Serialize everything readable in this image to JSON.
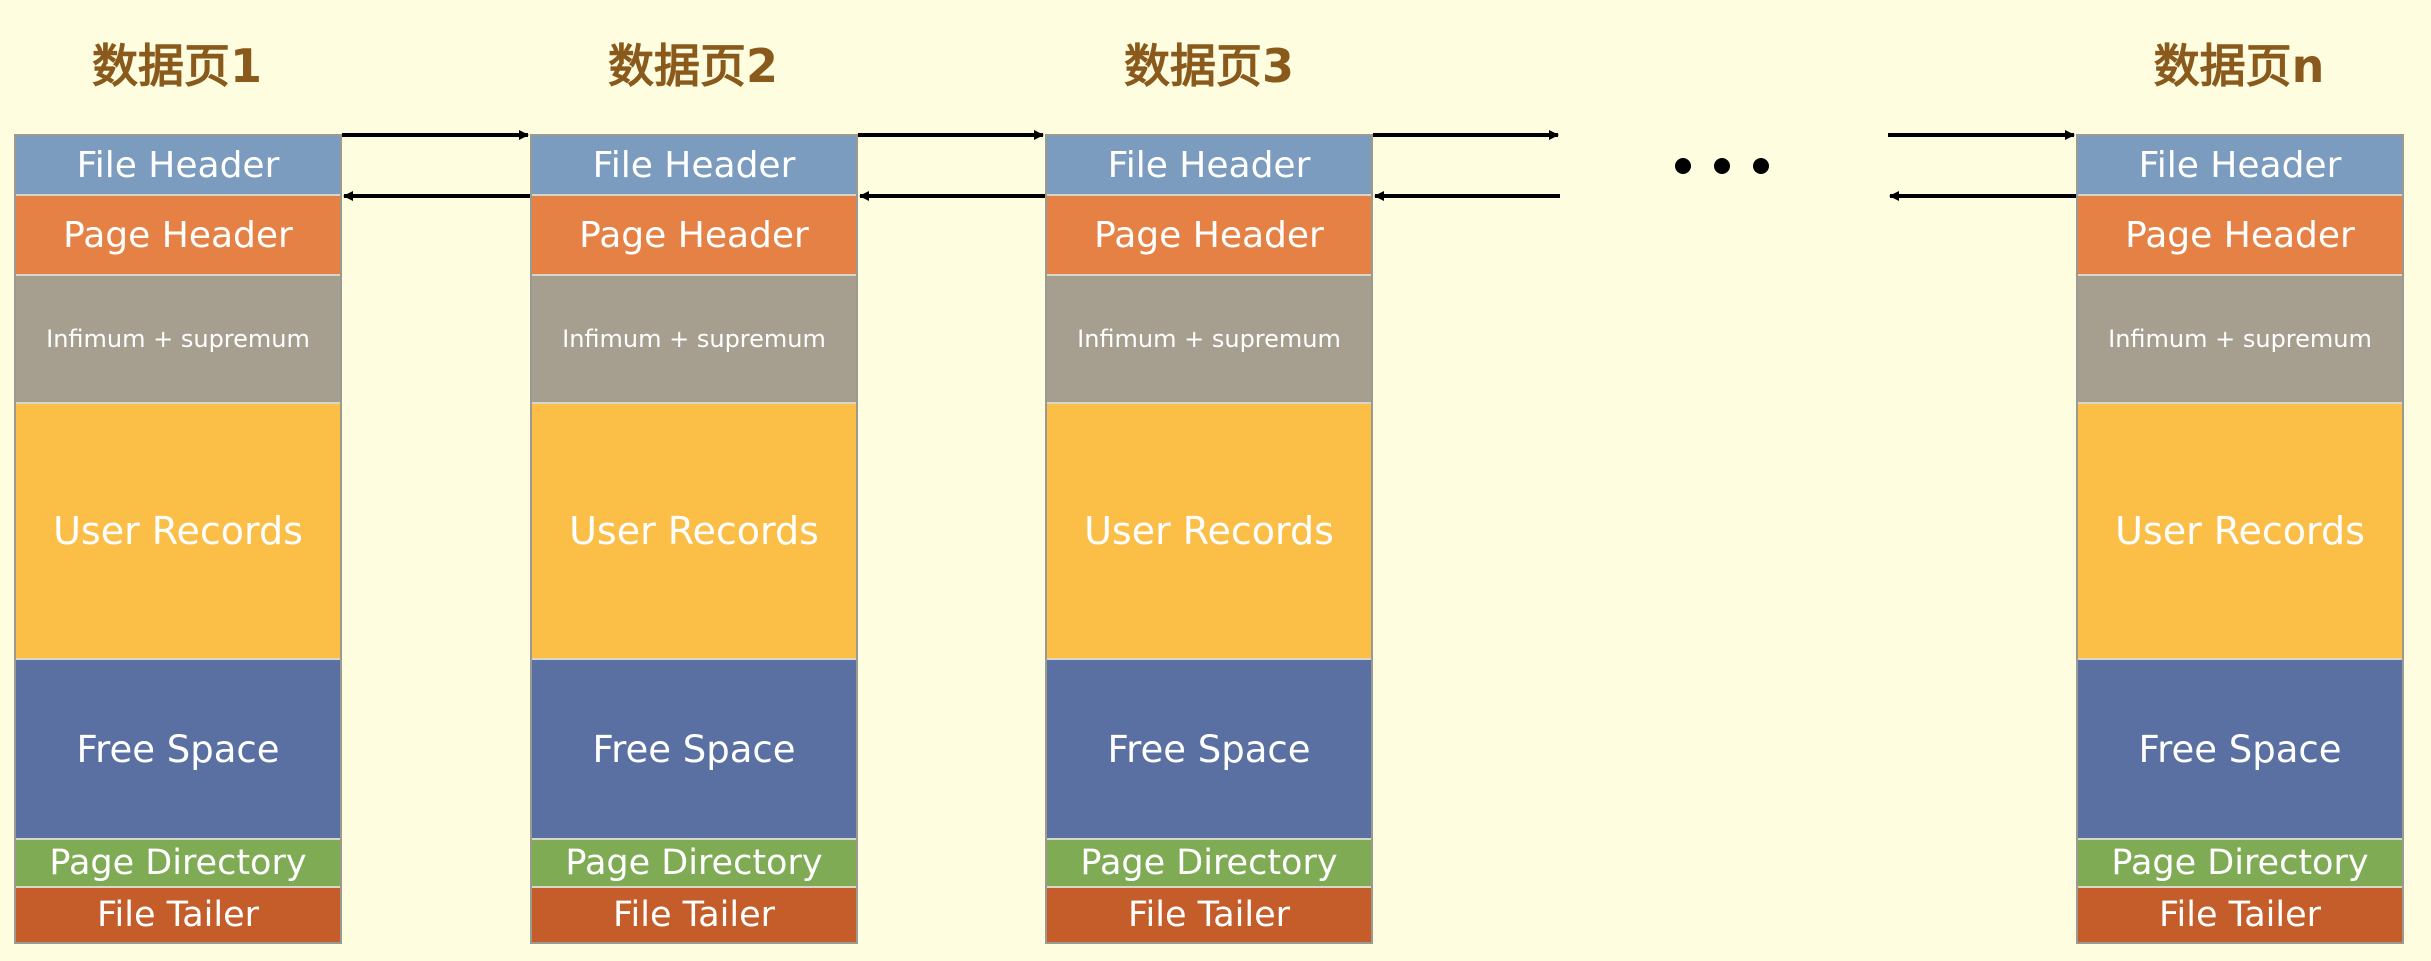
{
  "pages": [
    {
      "title": "数据页1",
      "sections": {
        "file_header": "File Header",
        "page_header": "Page Header",
        "infimum_supremum": "Infimum + supremum",
        "user_records": "User Records",
        "free_space": "Free Space",
        "page_directory": "Page Directory",
        "file_tailer": "File Tailer"
      }
    },
    {
      "title": "数据页2",
      "sections": {
        "file_header": "File Header",
        "page_header": "Page Header",
        "infimum_supremum": "Infimum + supremum",
        "user_records": "User Records",
        "free_space": "Free Space",
        "page_directory": "Page Directory",
        "file_tailer": "File Tailer"
      }
    },
    {
      "title": "数据页3",
      "sections": {
        "file_header": "File Header",
        "page_header": "Page Header",
        "infimum_supremum": "Infimum + supremum",
        "user_records": "User Records",
        "free_space": "Free Space",
        "page_directory": "Page Directory",
        "file_tailer": "File Tailer"
      }
    },
    {
      "title": "数据页n",
      "sections": {
        "file_header": "File Header",
        "page_header": "Page Header",
        "infimum_supremum": "Infimum + supremum",
        "user_records": "User Records",
        "free_space": "Free Space",
        "page_directory": "Page Directory",
        "file_tailer": "File Tailer"
      }
    }
  ],
  "colors": {
    "background": "#fffde0",
    "title": "#8a5a1c",
    "file_header": "#7b9bbf",
    "page_header": "#e58145",
    "infimum_supremum": "#a69e8f",
    "user_records": "#fbbe47",
    "free_space": "#5a6fa2",
    "page_directory": "#7fab55",
    "file_tailer": "#c45d2a",
    "arrow": "#000000"
  }
}
